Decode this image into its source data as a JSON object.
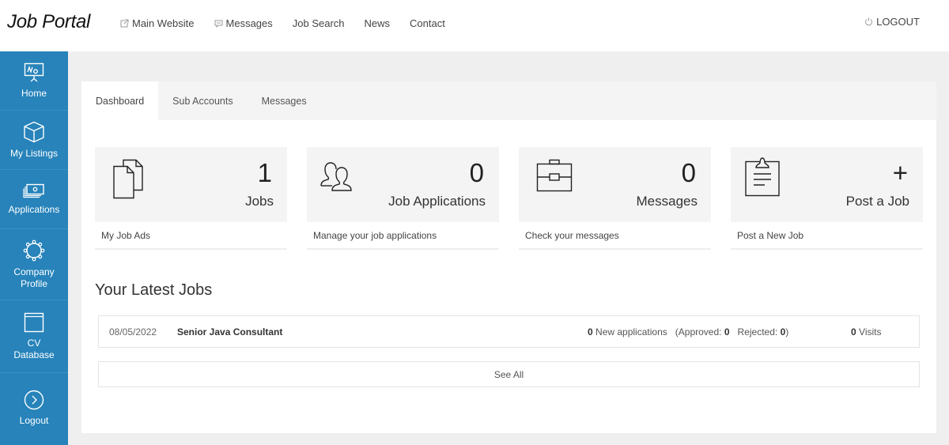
{
  "header": {
    "title": "Job Portal",
    "nav": [
      {
        "label": "Main Website",
        "icon": "external-link-icon"
      },
      {
        "label": "Messages",
        "icon": "chat-icon"
      },
      {
        "label": "Job Search"
      },
      {
        "label": "News"
      },
      {
        "label": "Contact"
      }
    ],
    "logout_label": "LOGOUT"
  },
  "sidebar": {
    "items": [
      {
        "label": "Home",
        "icon": "presentation-board-icon"
      },
      {
        "label": "My Listings",
        "icon": "cube-icon"
      },
      {
        "label": "Applications",
        "icon": "banknotes-icon"
      },
      {
        "label": "Company Profile",
        "line1": "Company",
        "line2": "Profile",
        "icon": "gear-icon"
      },
      {
        "label": "CV Database",
        "line1": "CV",
        "line2": "Database",
        "icon": "window-icon"
      },
      {
        "label": "Logout",
        "icon": "chevron-right-circle-icon"
      }
    ],
    "color": "#2783ba"
  },
  "tabs": [
    {
      "label": "Dashboard",
      "active": true
    },
    {
      "label": "Sub Accounts",
      "active": false
    },
    {
      "label": "Messages",
      "active": false
    }
  ],
  "cards": [
    {
      "value": "1",
      "label": "Jobs",
      "subtitle": "My Job Ads",
      "icon": "documents-icon"
    },
    {
      "value": "0",
      "label": "Job Applications",
      "subtitle": "Manage your job applications",
      "icon": "users-icon"
    },
    {
      "value": "0",
      "label": "Messages",
      "subtitle": "Check your messages",
      "icon": "briefcase-icon"
    },
    {
      "value": "+",
      "label": "Post a Job",
      "subtitle": "Post a New Job",
      "icon": "clipboard-icon"
    }
  ],
  "latest": {
    "title": "Your Latest Jobs",
    "jobs": [
      {
        "date": "08/05/2022",
        "title": "Senior Java Consultant",
        "new_applications": "0",
        "new_applications_label": "New applications",
        "approved_label": "(Approved:",
        "approved": "0",
        "rejected_label": "Rejected:",
        "rejected": "0",
        "visits": "0",
        "visits_label": "Visits"
      }
    ],
    "see_all_label": "See All"
  }
}
